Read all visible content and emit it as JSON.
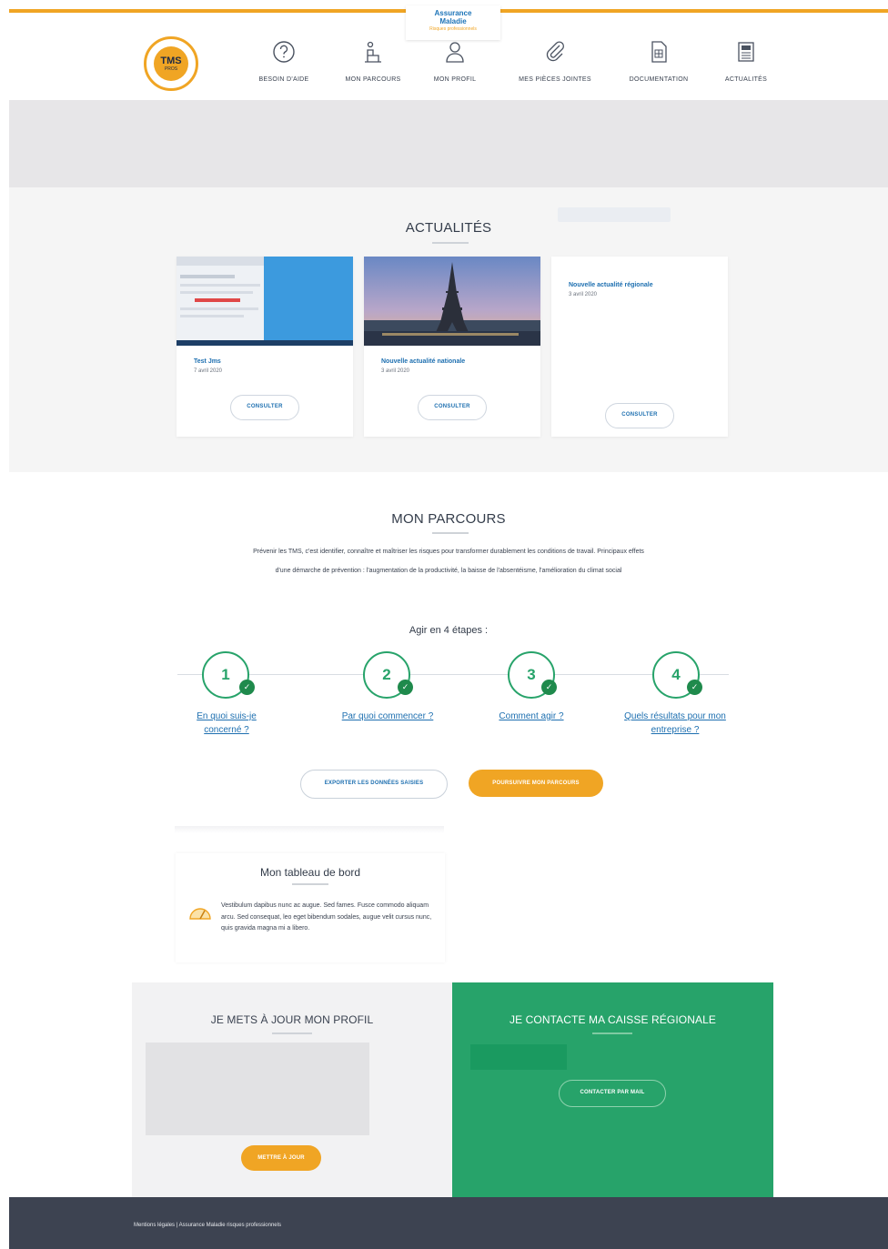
{
  "brand": {
    "top_logo_line1": "Assurance",
    "top_logo_line2": "Maladie",
    "top_logo_line3": "Risques professionnels",
    "tms_main": "TMS",
    "tms_sub": "PROS"
  },
  "nav": {
    "items": [
      {
        "label": "BESOIN D'AIDE",
        "icon": "question-icon"
      },
      {
        "label": "MON PARCOURS",
        "icon": "parcours-icon"
      },
      {
        "label": "MON PROFIL",
        "icon": "user-icon"
      },
      {
        "label": "MES PIÈCES JOINTES",
        "icon": "paperclip-icon"
      },
      {
        "label": "DOCUMENTATION",
        "icon": "document-icon"
      },
      {
        "label": "ACTUALITÉS",
        "icon": "news-icon"
      }
    ]
  },
  "actualites": {
    "title": "ACTUALITÉS",
    "cards": [
      {
        "title": "Test Jms",
        "date": "7 avril 2020",
        "button": "CONSULTER"
      },
      {
        "title": "Nouvelle actualité nationale",
        "date": "3 avril 2020",
        "button": "CONSULTER"
      },
      {
        "title": "Nouvelle actualité régionale",
        "date": "3 avril 2020",
        "button": "CONSULTER"
      }
    ]
  },
  "parcours": {
    "title": "MON PARCOURS",
    "description": "Prévenir les TMS, c'est identifier, connaître et maîtriser les risques pour transformer durablement les conditions de travail. Principaux effets d'une démarche de prévention : l'augmentation de la productivité, la baisse de l'absentéisme, l'amélioration du climat social",
    "steps_title": "Agir en 4 étapes :",
    "steps": [
      {
        "number": "1",
        "label": "En quoi suis-je concerné ?"
      },
      {
        "number": "2",
        "label": "Par quoi commencer ?"
      },
      {
        "number": "3",
        "label": "Comment agir ?"
      },
      {
        "number": "4",
        "label": "Quels résultats pour mon entreprise ?"
      }
    ],
    "export_button": "EXPORTER LES DONNÉES SAISIES",
    "continue_button": "POURSUIVRE MON PARCOURS"
  },
  "dashboard": {
    "title": "Mon tableau de bord",
    "text": "Vestibulum dapibus nunc ac augue. Sed fames. Fusce commodo aliquam arcu. Sed consequat, leo eget bibendum sodales, augue velit cursus nunc, quis gravida magna mi a libero."
  },
  "profil_panel": {
    "title": "JE METS À JOUR MON PROFIL",
    "button": "METTRE À JOUR"
  },
  "contact_panel": {
    "title": "JE CONTACTE MA CAISSE RÉGIONALE",
    "button": "CONTACTER PAR MAIL"
  },
  "footer": {
    "text": "Mentions légales  |  Assurance Maladie risques professionnels"
  },
  "colors": {
    "accent_orange": "#f0a524",
    "green": "#27a36a",
    "link_blue": "#1d6fb0",
    "footer": "#3d4351"
  }
}
